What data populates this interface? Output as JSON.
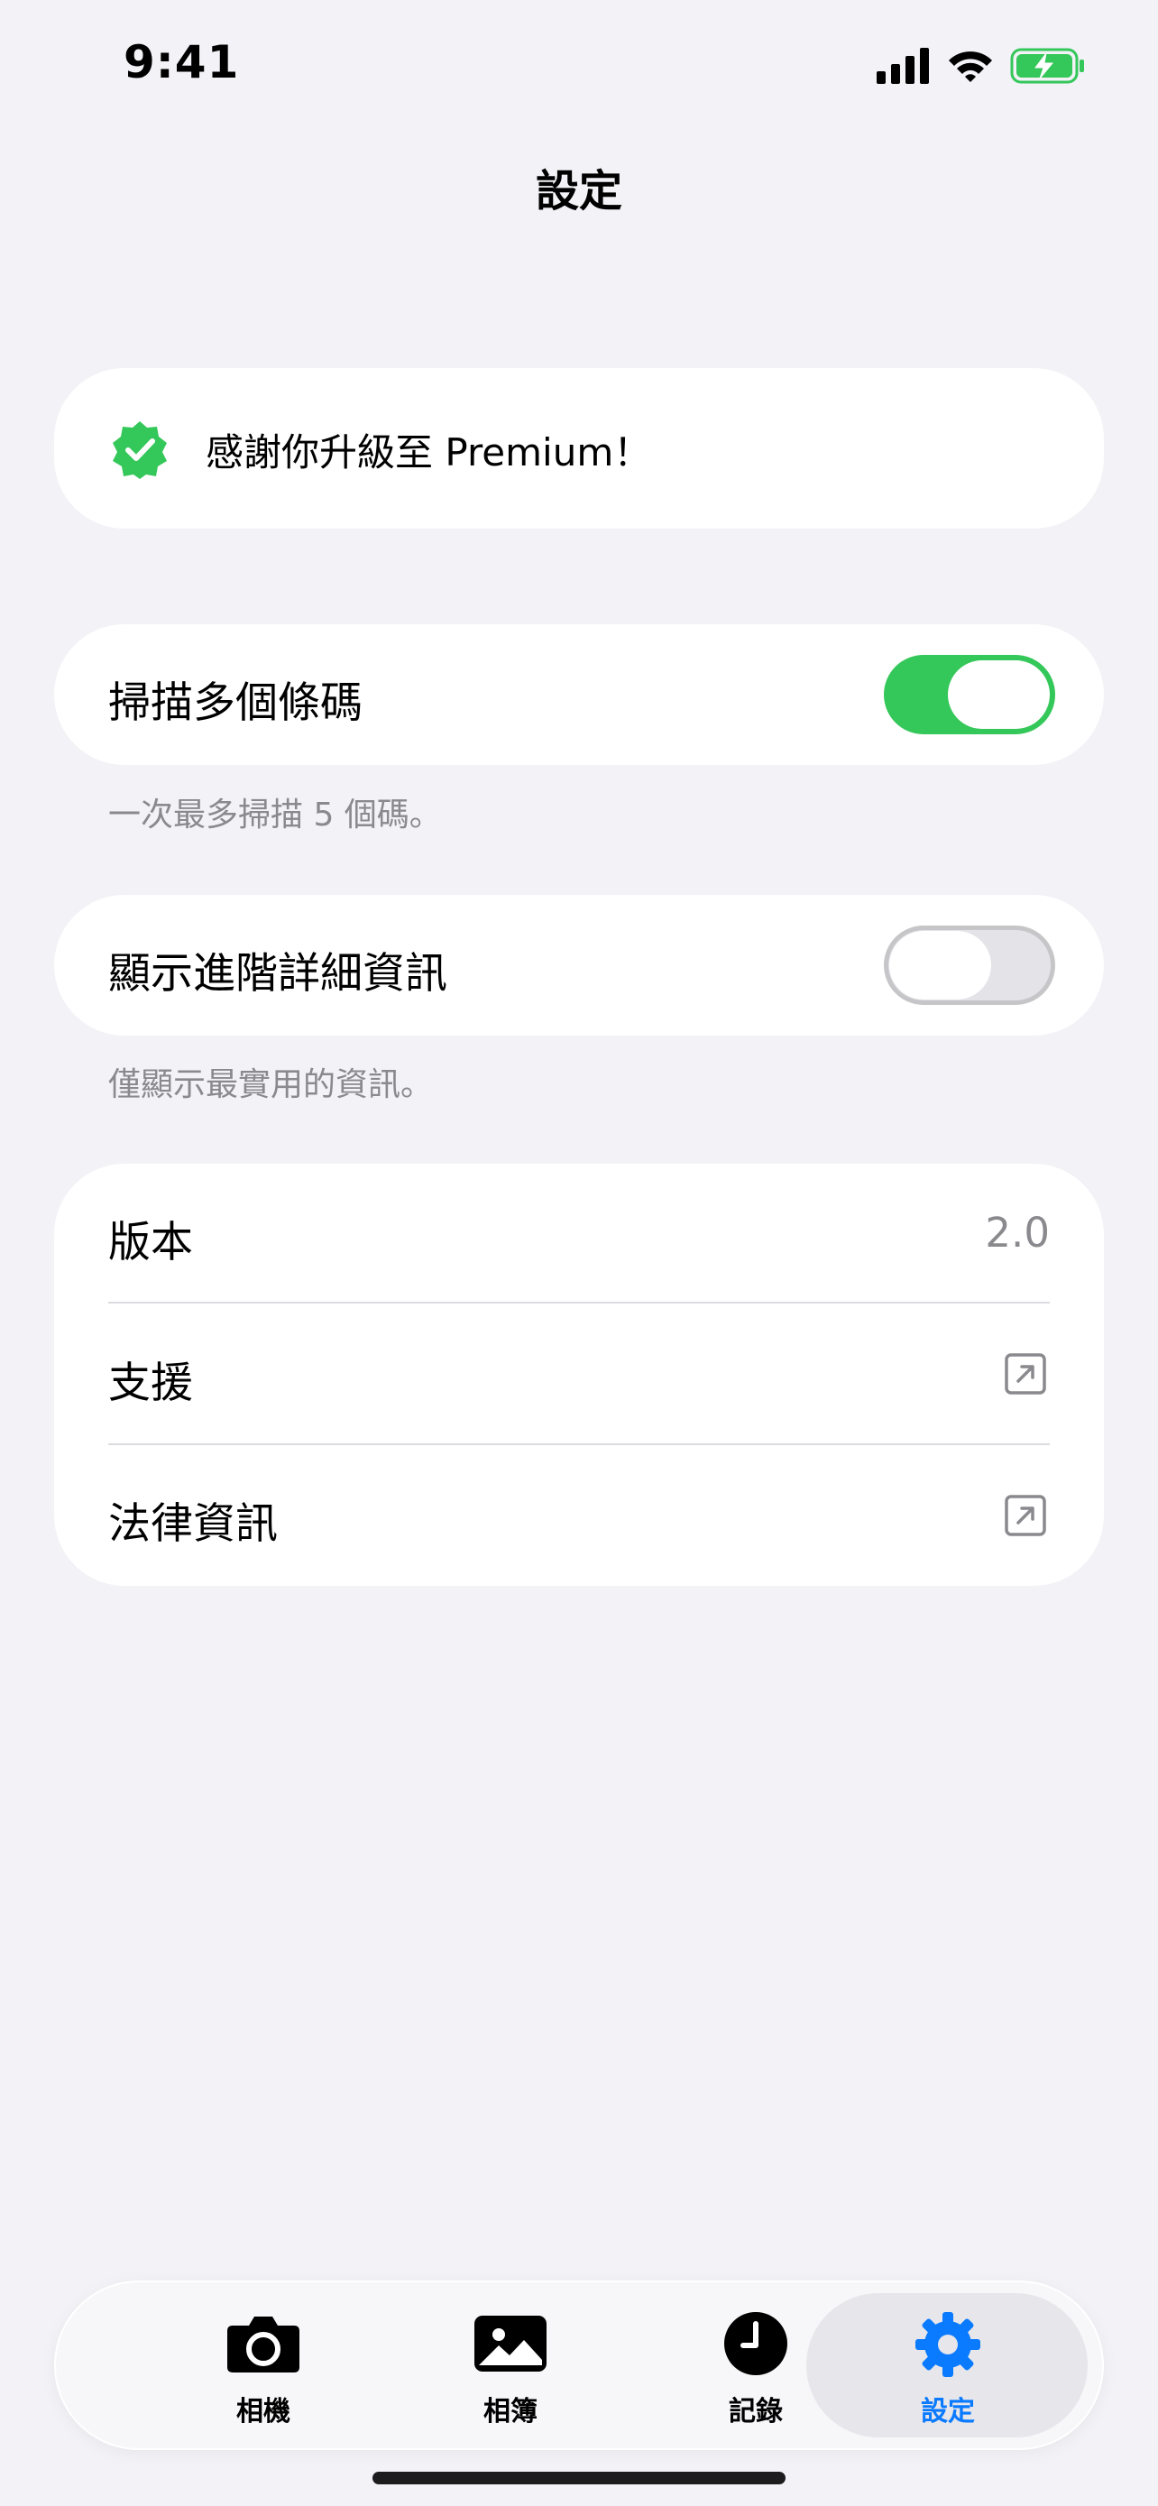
{
  "status_bar": {
    "time": "9:41"
  },
  "nav": {
    "title": "設定"
  },
  "premium": {
    "text": "感謝你升級至 Premium！"
  },
  "settings": {
    "scan_multiple": {
      "label": "掃描多個條碼",
      "enabled": true,
      "footnote": "一次最多掃描 5 個碼。"
    },
    "advanced_details": {
      "label": "顯示進階詳細資訊",
      "enabled": false,
      "footnote": "僅顯示最實用的資訊。"
    }
  },
  "info": {
    "version_label": "版本",
    "version_value": "2.0",
    "support_label": "支援",
    "legal_label": "法律資訊"
  },
  "tabs": [
    {
      "label": "相機",
      "icon": "camera-icon"
    },
    {
      "label": "相簿",
      "icon": "photo-icon"
    },
    {
      "label": "記錄",
      "icon": "clock-icon"
    },
    {
      "label": "設定",
      "icon": "gear-icon",
      "active": true
    }
  ],
  "colors": {
    "accent": "#0a7aff",
    "toggle_on": "#34c759",
    "background": "#f2f2f7"
  }
}
